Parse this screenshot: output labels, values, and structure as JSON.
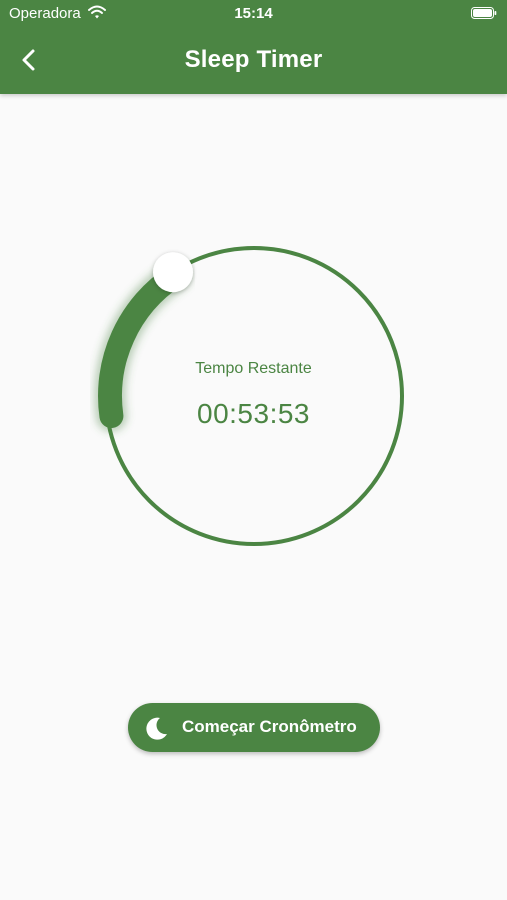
{
  "status_bar": {
    "carrier": "Operadora",
    "time": "15:14",
    "wifi_icon": "wifi-icon",
    "battery_icon": "battery-icon"
  },
  "header": {
    "title": "Sleep Timer",
    "back_icon": "chevron-left-icon",
    "background_color": "#4b8543"
  },
  "timer": {
    "label": "Tempo Restante",
    "remaining": "00:53:53",
    "progress_fraction": 0.18,
    "accent_color": "#4b8543"
  },
  "start_button": {
    "label": "Começar Cronômetro",
    "icon": "moon-icon"
  }
}
